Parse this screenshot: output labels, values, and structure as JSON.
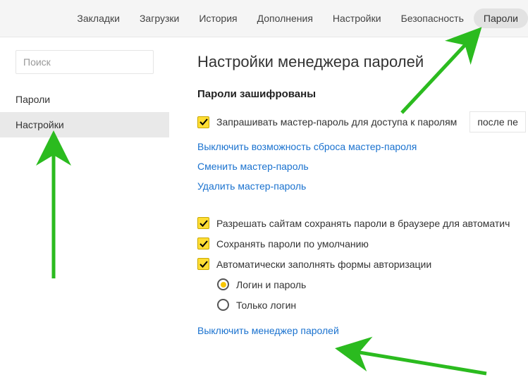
{
  "top_tabs": {
    "items": [
      "Закладки",
      "Загрузки",
      "История",
      "Дополнения",
      "Настройки",
      "Безопасность",
      "Пароли"
    ],
    "active_index": 6
  },
  "sidebar": {
    "search_placeholder": "Поиск",
    "items": [
      "Пароли",
      "Настройки"
    ],
    "active_index": 1
  },
  "main": {
    "title": "Настройки менеджера паролей",
    "section1": {
      "heading": "Пароли зашифрованы",
      "checkbox1_label": "Запрашивать мастер-пароль для доступа к паролям",
      "dropdown_value": "после пе",
      "link1": "Выключить возможность сброса мастер-пароля",
      "link2": "Сменить мастер-пароль",
      "link3": "Удалить мастер-пароль"
    },
    "section2": {
      "checkbox1_label": "Разрешать сайтам сохранять пароли в браузере для автоматич",
      "checkbox2_label": "Сохранять пароли по умолчанию",
      "checkbox3_label": "Автоматически заполнять формы авторизации",
      "radio1_label": "Логин и пароль",
      "radio2_label": "Только логин",
      "link1": "Выключить менеджер паролей"
    }
  }
}
